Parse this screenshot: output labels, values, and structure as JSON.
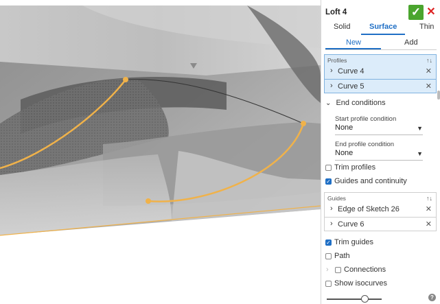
{
  "feature": {
    "title": "Loft 4",
    "ok_icon": "checkmark-icon",
    "cancel_icon": "close-icon"
  },
  "type_tabs": [
    {
      "label": "Solid"
    },
    {
      "label": "Surface"
    },
    {
      "label": "Thin"
    }
  ],
  "type_tabs_active": "Surface",
  "creation_tabs": [
    {
      "label": "New"
    },
    {
      "label": "Add"
    }
  ],
  "creation_tabs_active": "New",
  "profiles": {
    "label": "Profiles",
    "items": [
      {
        "label": "Curve 4"
      },
      {
        "label": "Curve 5"
      }
    ]
  },
  "end_conditions": {
    "label": "End conditions",
    "start_label": "Start profile condition",
    "start_value": "None",
    "end_label": "End profile condition",
    "end_value": "None"
  },
  "trim_profiles": {
    "label": "Trim profiles",
    "checked": false
  },
  "guides_continuity": {
    "label": "Guides and continuity",
    "checked": true
  },
  "guides": {
    "label": "Guides",
    "items": [
      {
        "label": "Edge of Sketch 26"
      },
      {
        "label": "Curve 6"
      }
    ]
  },
  "trim_guides": {
    "label": "Trim guides",
    "checked": true
  },
  "path": {
    "label": "Path",
    "checked": false
  },
  "connections": {
    "label": "Connections",
    "checked": false
  },
  "show_isocurves": {
    "label": "Show isocurves",
    "checked": false
  },
  "isocurve_slider": {
    "value_fraction": 0.68
  },
  "help_icon": "?",
  "colors": {
    "accent": "#1f6fc5",
    "ok": "#4aa52e",
    "cancel": "#dd2222",
    "curve": "#f0b24a",
    "selection": "#dcecfa"
  }
}
